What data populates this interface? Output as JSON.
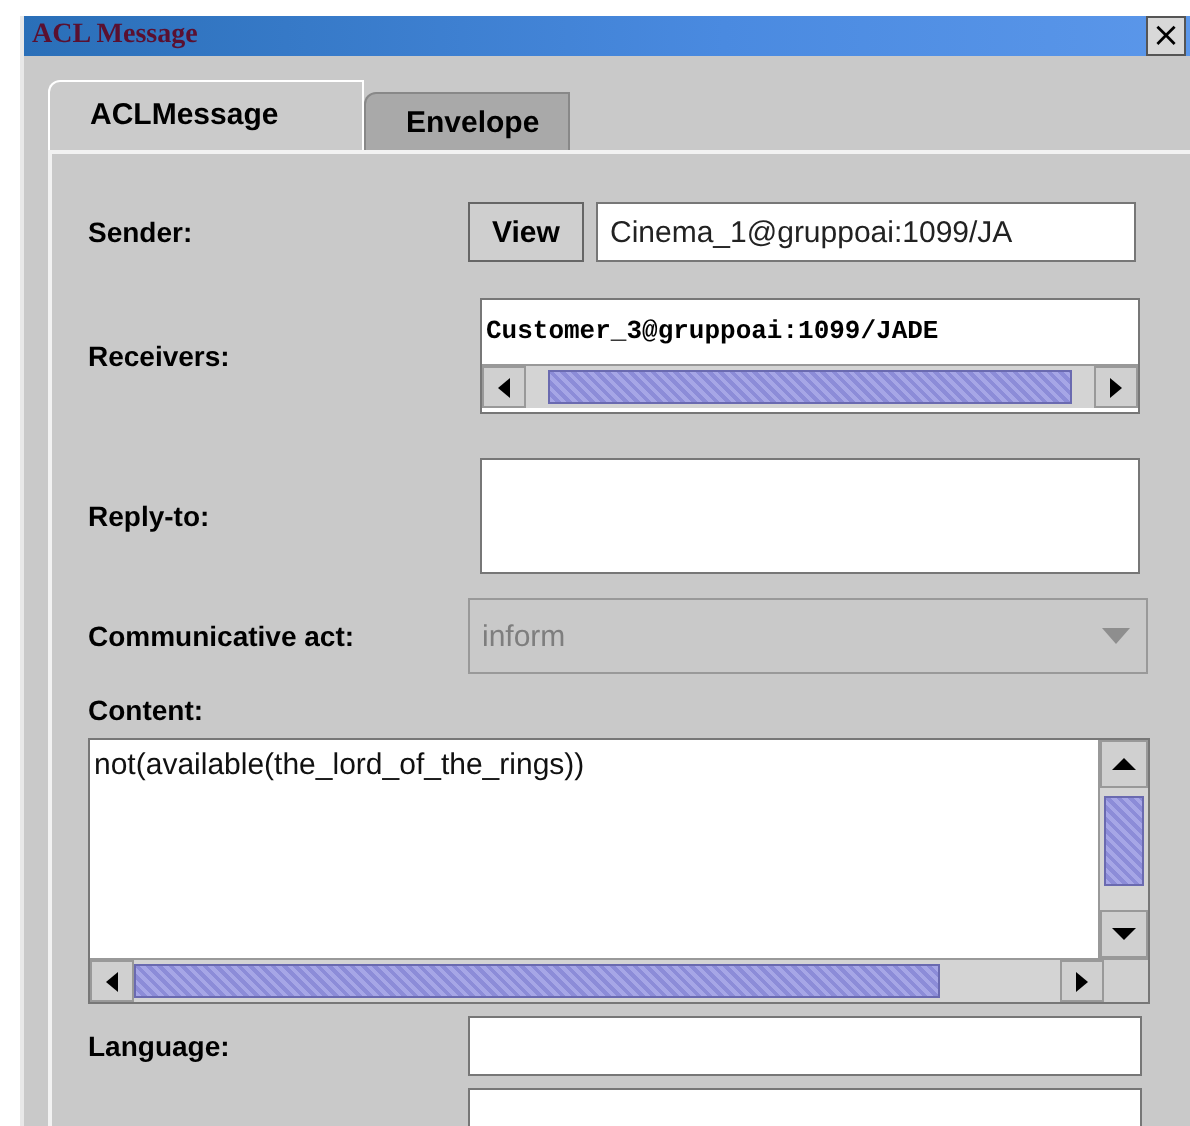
{
  "window": {
    "title": "ACL Message",
    "close": "×"
  },
  "tabs": [
    {
      "label": "ACLMessage",
      "selected": true
    },
    {
      "label": "Envelope",
      "selected": false
    }
  ],
  "sender": {
    "label": "Sender:",
    "button": "View",
    "value": "Cinema_1@gruppoai:1099/JA"
  },
  "receivers": {
    "label": "Receivers:",
    "value": "Customer_3@gruppoai:1099/JADE"
  },
  "reply_to": {
    "label": "Reply-to:"
  },
  "communicative_act": {
    "label": "Communicative act:",
    "value": "inform",
    "disabled": true
  },
  "content": {
    "label": "Content:",
    "value": "not(available(the_lord_of_the_rings))"
  },
  "language": {
    "label": "Language:"
  }
}
